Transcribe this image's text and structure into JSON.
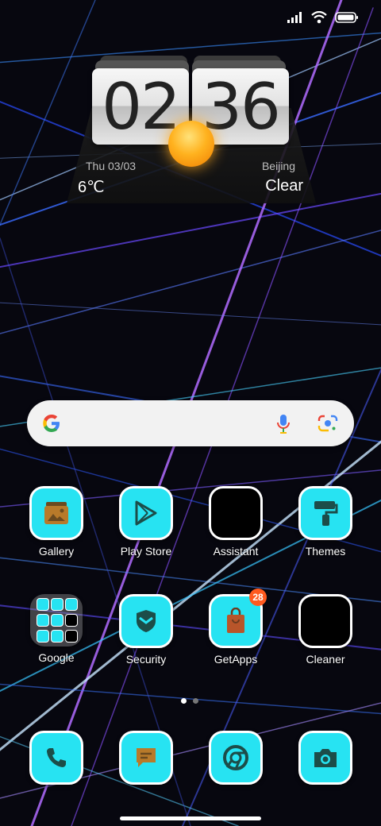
{
  "status": {
    "icons": [
      "signal-icon",
      "wifi-icon",
      "battery-icon"
    ]
  },
  "clock": {
    "hours": "02",
    "minutes": "36"
  },
  "weather": {
    "day": "Thu  03/03",
    "city": "Beijing",
    "temp": "6℃",
    "condition": "Clear",
    "icon": "sun-icon"
  },
  "search": {
    "icons": [
      "google-logo",
      "mic-icon",
      "lens-icon"
    ]
  },
  "apps_row1": [
    {
      "label": "Gallery",
      "icon": "gallery-icon"
    },
    {
      "label": "Play Store",
      "icon": "play-store-icon"
    },
    {
      "label": "Assistant",
      "icon": "assistant-icon"
    },
    {
      "label": "Themes",
      "icon": "themes-icon"
    }
  ],
  "apps_row2": [
    {
      "label": "Google",
      "icon": "folder-icon"
    },
    {
      "label": "Security",
      "icon": "security-icon"
    },
    {
      "label": "GetApps",
      "icon": "getapps-icon",
      "badge": "28"
    },
    {
      "label": "Cleaner",
      "icon": "cleaner-icon"
    }
  ],
  "dock": [
    {
      "icon": "phone-icon"
    },
    {
      "icon": "messages-icon"
    },
    {
      "icon": "chrome-icon"
    },
    {
      "icon": "camera-icon"
    }
  ],
  "pager": {
    "pages": 2,
    "current": 1
  },
  "colors": {
    "tile": "#27e3f2",
    "tile_glyph": "#1c4d49",
    "badge": "#ff5a1f"
  }
}
